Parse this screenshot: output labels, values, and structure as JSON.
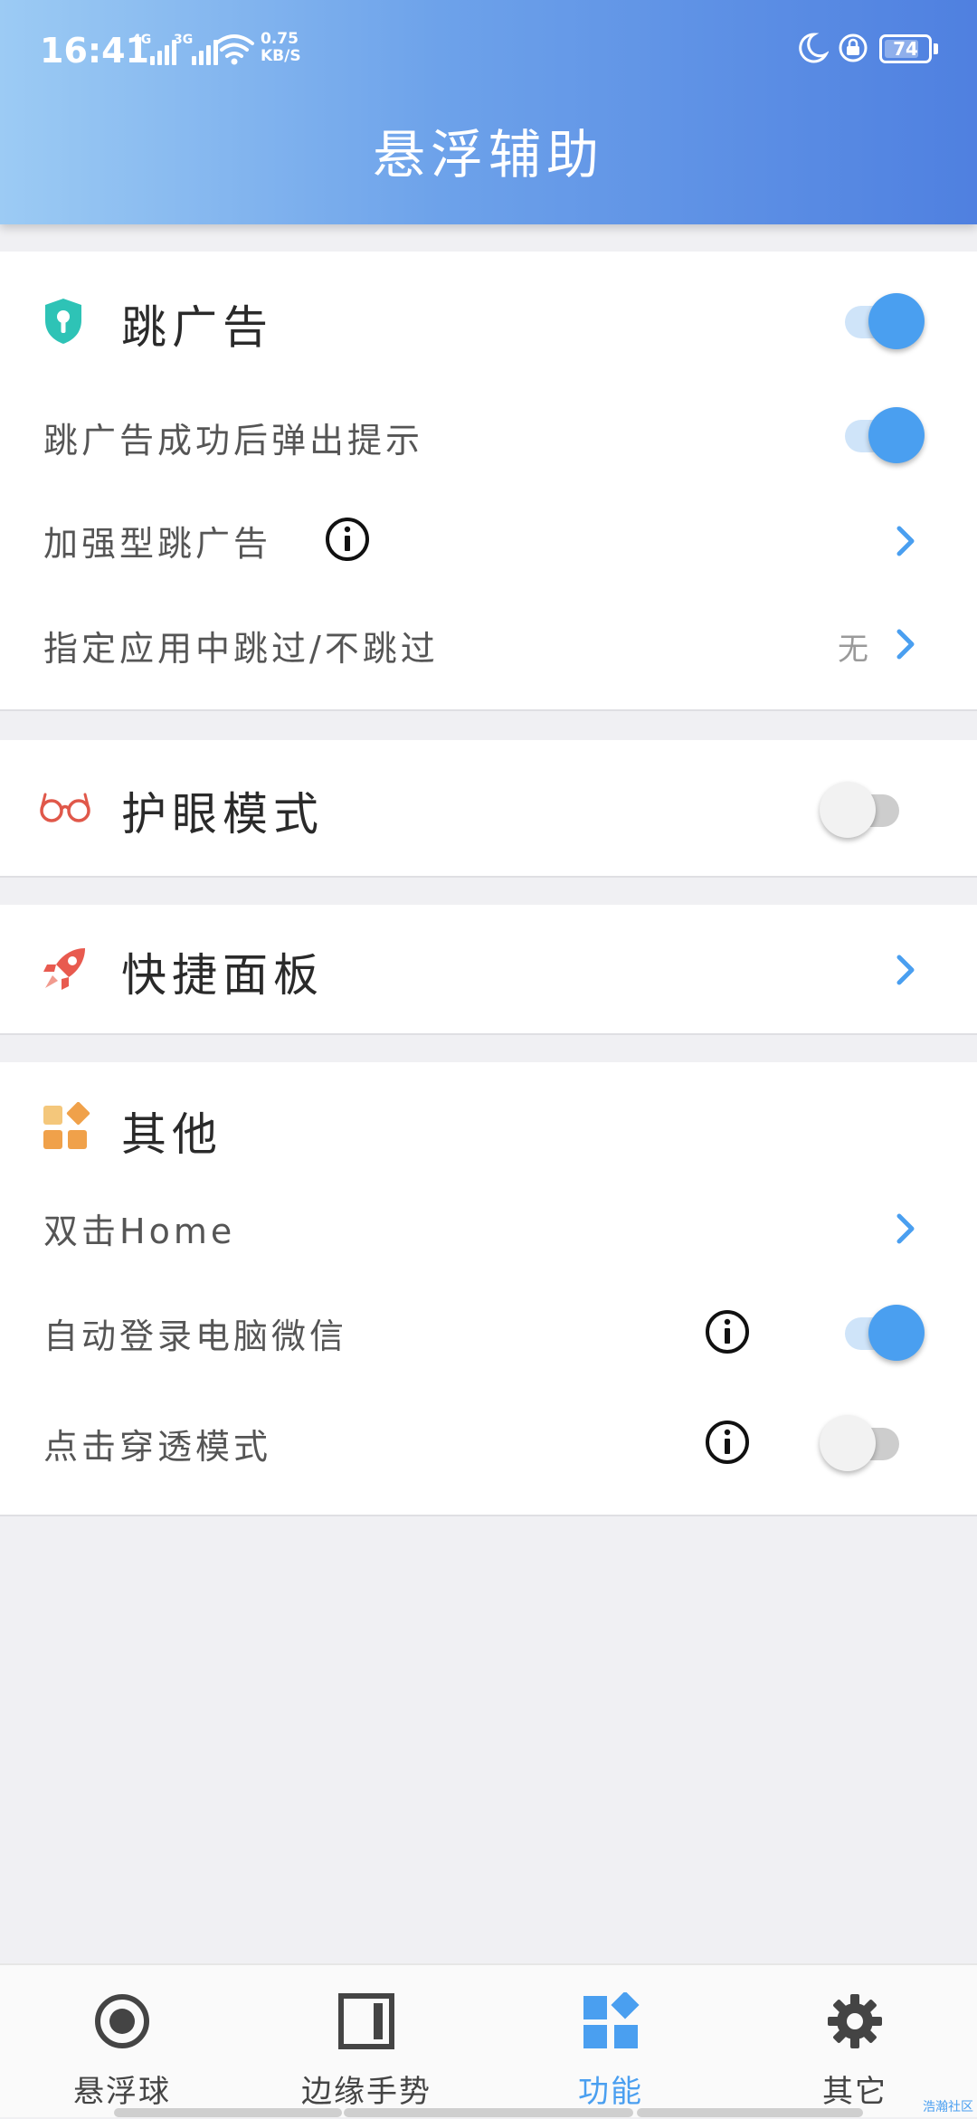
{
  "status_bar": {
    "time": "16:41",
    "signal1_gen": "4G",
    "signal2_gen": "3G",
    "speed_value": "0.75",
    "speed_unit": "KB/S",
    "battery": "74"
  },
  "header": {
    "title": "悬浮辅助"
  },
  "skip_ads": {
    "title": "跳广告",
    "title_toggle": true,
    "popup_label": "跳广告成功后弹出提示",
    "popup_toggle": true,
    "enhanced_label": "加强型跳广告",
    "apps_label": "指定应用中跳过/不跳过",
    "apps_value": "无"
  },
  "eye_care": {
    "title": "护眼模式",
    "toggle": false
  },
  "quick_panel": {
    "title": "快捷面板"
  },
  "other": {
    "title": "其他",
    "double_home_label": "双击Home",
    "auto_login_label": "自动登录电脑微信",
    "auto_login_toggle": true,
    "click_through_label": "点击穿透模式",
    "click_through_toggle": false
  },
  "tabs": [
    {
      "label": "悬浮球",
      "icon": "record-circle-icon",
      "active": false
    },
    {
      "label": "边缘手势",
      "icon": "edge-panel-icon",
      "active": false
    },
    {
      "label": "功能",
      "icon": "widgets-icon",
      "active": true
    },
    {
      "label": "其它",
      "icon": "gear-icon",
      "active": false
    }
  ],
  "colors": {
    "accent": "#4a9ff0",
    "header_start": "#9ccbf4",
    "header_end": "#4f80e0"
  },
  "watermark": "浩瀚社区"
}
